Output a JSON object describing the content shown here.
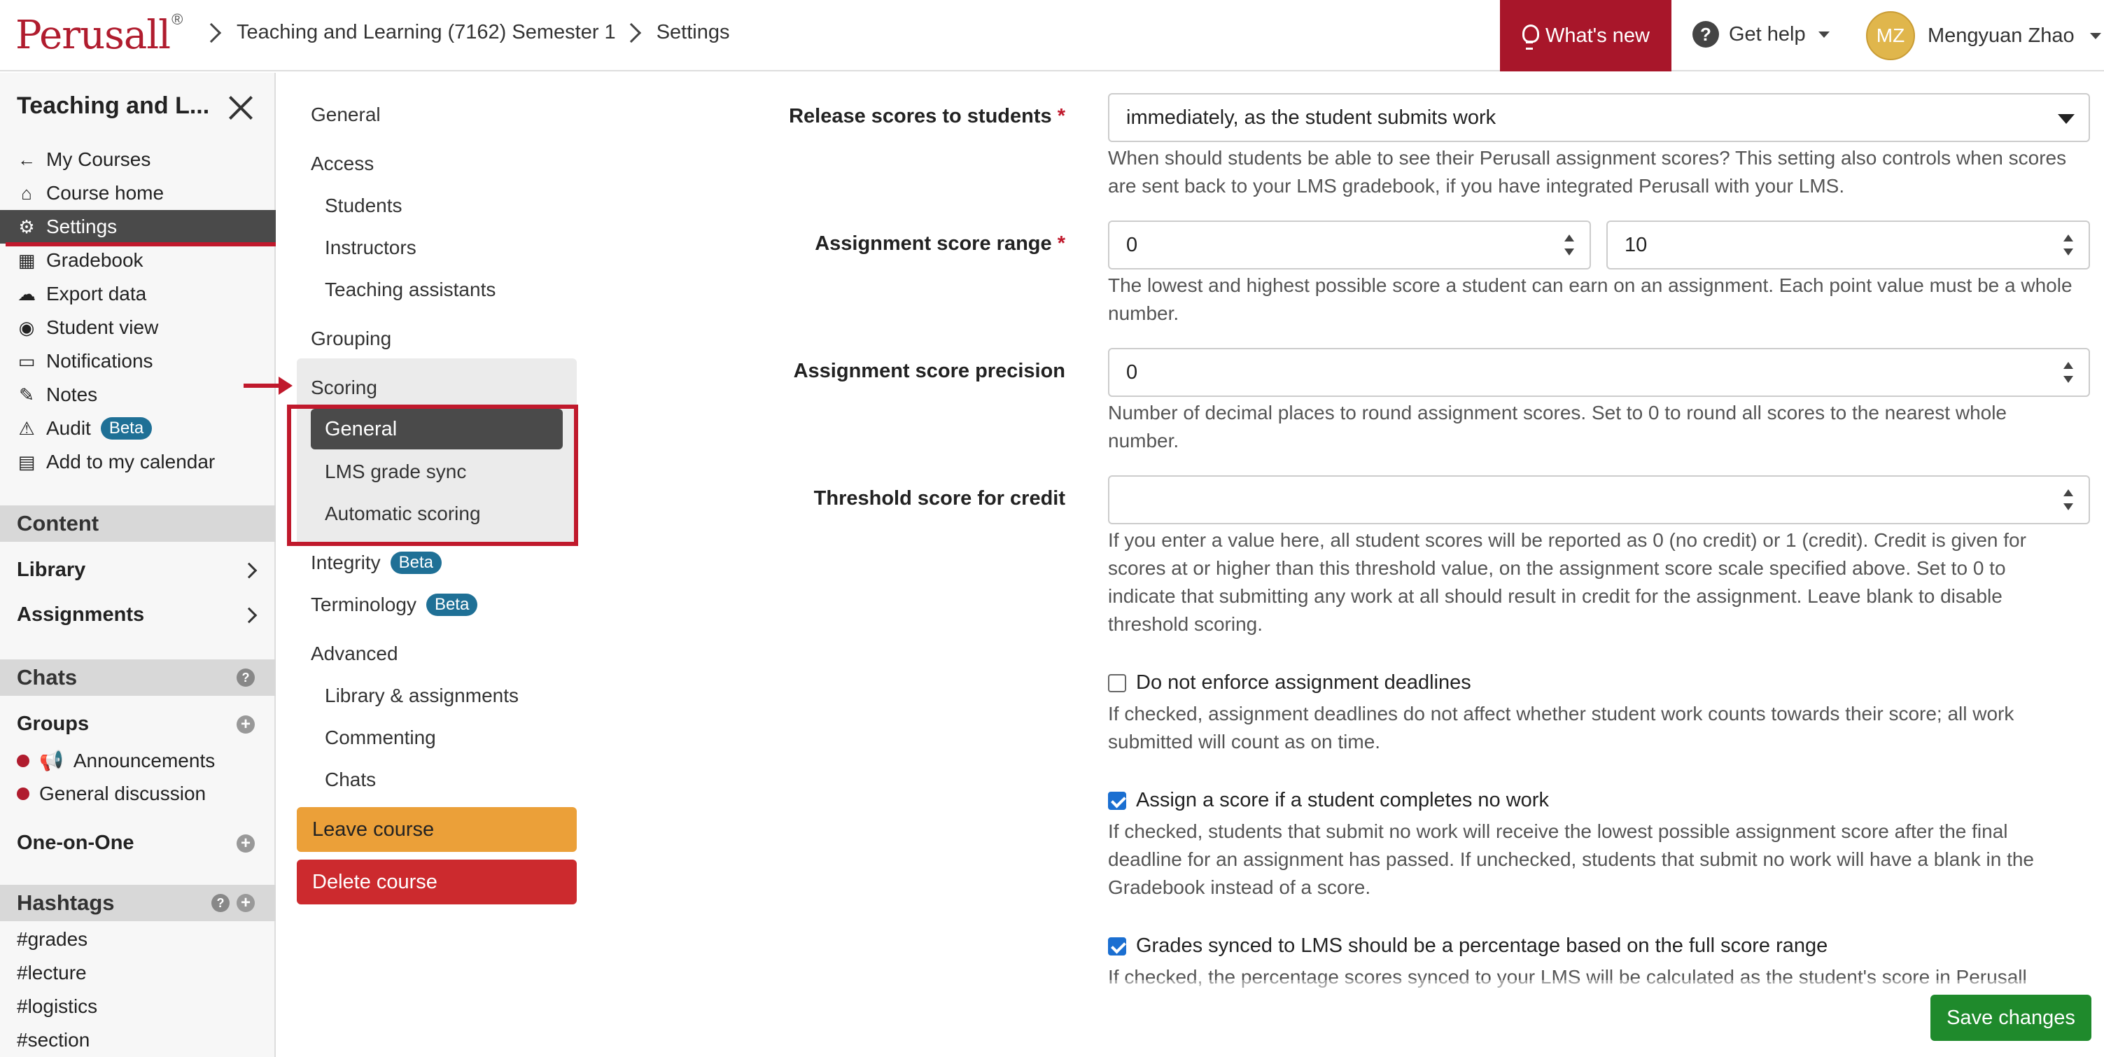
{
  "header": {
    "logo": "Perusall",
    "logo_reg": "®",
    "breadcrumb": [
      "Teaching and Learning (7162) Semester 1",
      "Settings"
    ],
    "whats_new": "What's new",
    "get_help": "Get help",
    "user_initials": "MZ",
    "user_name": "Mengyuan Zhao",
    "accent": "#a8162a"
  },
  "sidebar": {
    "title": "Teaching and L...",
    "nav": [
      {
        "label": "My Courses",
        "icon": "arrow-left-icon"
      },
      {
        "label": "Course home",
        "icon": "home-icon"
      },
      {
        "label": "Settings",
        "icon": "gear-icon",
        "active": true
      },
      {
        "label": "Gradebook",
        "icon": "table-icon"
      },
      {
        "label": "Export data",
        "icon": "cloud-download-icon"
      },
      {
        "label": "Student view",
        "icon": "eye-icon"
      },
      {
        "label": "Notifications",
        "icon": "inbox-icon"
      },
      {
        "label": "Notes",
        "icon": "pencil-icon"
      },
      {
        "label": "Audit",
        "icon": "warning-icon",
        "badge": "Beta"
      },
      {
        "label": "Add to my calendar",
        "icon": "calendar-icon"
      }
    ],
    "content_header": "Content",
    "library": "Library",
    "assignments": "Assignments",
    "chats_header": "Chats",
    "groups_label": "Groups",
    "groups": [
      "Announcements",
      "General discussion"
    ],
    "one_on_one": "One-on-One",
    "hashtags_header": "Hashtags",
    "hashtags": [
      "#grades",
      "#lecture",
      "#logistics",
      "#section"
    ]
  },
  "settings_menu": {
    "general": "General",
    "access": "Access",
    "access_items": [
      "Students",
      "Instructors",
      "Teaching assistants"
    ],
    "grouping": "Grouping",
    "scoring": "Scoring",
    "scoring_items": [
      "General",
      "LMS grade sync",
      "Automatic scoring"
    ],
    "integrity": "Integrity",
    "terminology": "Terminology",
    "beta": "Beta",
    "advanced": "Advanced",
    "advanced_items": [
      "Library & assignments",
      "Commenting",
      "Chats"
    ],
    "leave": "Leave course",
    "delete": "Delete course"
  },
  "form": {
    "release": {
      "label": "Release scores to students",
      "value": "immediately, as the student submits work",
      "help": "When should students be able to see their Perusall assignment scores? This setting also controls when scores are sent back to your LMS gradebook, if you have integrated Perusall with your LMS."
    },
    "range": {
      "label": "Assignment score range",
      "min": "0",
      "max": "10",
      "help": "The lowest and highest possible score a student can earn on an assignment. Each point value must be a whole number."
    },
    "precision": {
      "label": "Assignment score precision",
      "value": "0",
      "help": "Number of decimal places to round assignment scores. Set to 0 to round all scores to the nearest whole number."
    },
    "threshold": {
      "label": "Threshold score for credit",
      "value": "",
      "help": "If you enter a value here, all student scores will be reported as 0 (no credit) or 1 (credit). Credit is given for scores at or higher than this threshold value, on the assignment score scale specified above. Set to 0 to indicate that submitting any work at all should result in credit for the assignment. Leave blank to disable threshold scoring."
    },
    "deadlines": {
      "label": "Do not enforce assignment deadlines",
      "checked": false,
      "help": "If checked, assignment deadlines do not affect whether student work counts towards their score; all work submitted will count as on time."
    },
    "no_work": {
      "label": "Assign a score if a student completes no work",
      "checked": true,
      "help": "If checked, students that submit no work will receive the lowest possible assignment score after the final deadline for an assignment has passed. If unchecked, students that submit no work will have a blank in the Gradebook instead of a score."
    },
    "lms_pct": {
      "label": "Grades synced to LMS should be a percentage based on the full score range",
      "checked": true,
      "help": "If checked, the percentage scores synced to your LMS will be calculated as the student's score in Perusall"
    },
    "required_mark": "*"
  },
  "save_label": "Save changes"
}
